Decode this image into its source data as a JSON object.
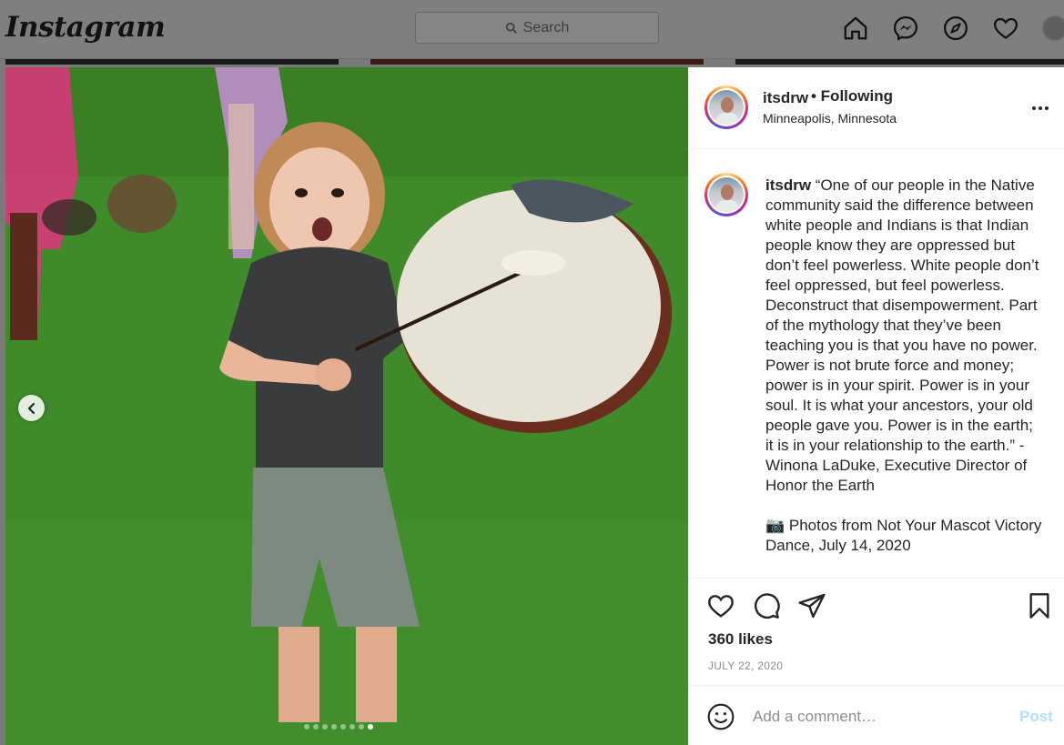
{
  "nav": {
    "logo": "Instagram",
    "search_placeholder": "Search",
    "icons": [
      "home-icon",
      "messenger-icon",
      "explore-icon",
      "heart-icon",
      "profile-avatar"
    ]
  },
  "post": {
    "username": "itsdrw",
    "following_label": "• Following",
    "location": "Minneapolis, Minnesota",
    "caption_username": "itsdrw",
    "caption_text": "“One of our people in the Native community said the difference between white people and Indians is that Indian people know they are oppressed but don’t feel powerless. White people don’t feel oppressed, but feel powerless. Deconstruct that disempowerment. Part of the mythology that they’ve been teaching you is that you have no power. Power is not brute force and money; power is in your spirit. Power is in your soul. It is what your ancestors, your old people gave you. Power is in the earth; it is in your relationship to the earth.” - Winona LaDuke, Executive Director of Honor the Earth",
    "caption_credit": "📷 Photos from Not Your Mascot Victory Dance, July 14, 2020",
    "likes": "360 likes",
    "date": "JULY 22, 2020",
    "comment_placeholder": "Add a comment…",
    "post_label": "Post"
  },
  "carousel": {
    "total_slides": 8,
    "active_slide": 8
  },
  "colors": {
    "accent_disabled": "#b2dffc",
    "text": "#262626",
    "muted": "#8e8e8e"
  }
}
